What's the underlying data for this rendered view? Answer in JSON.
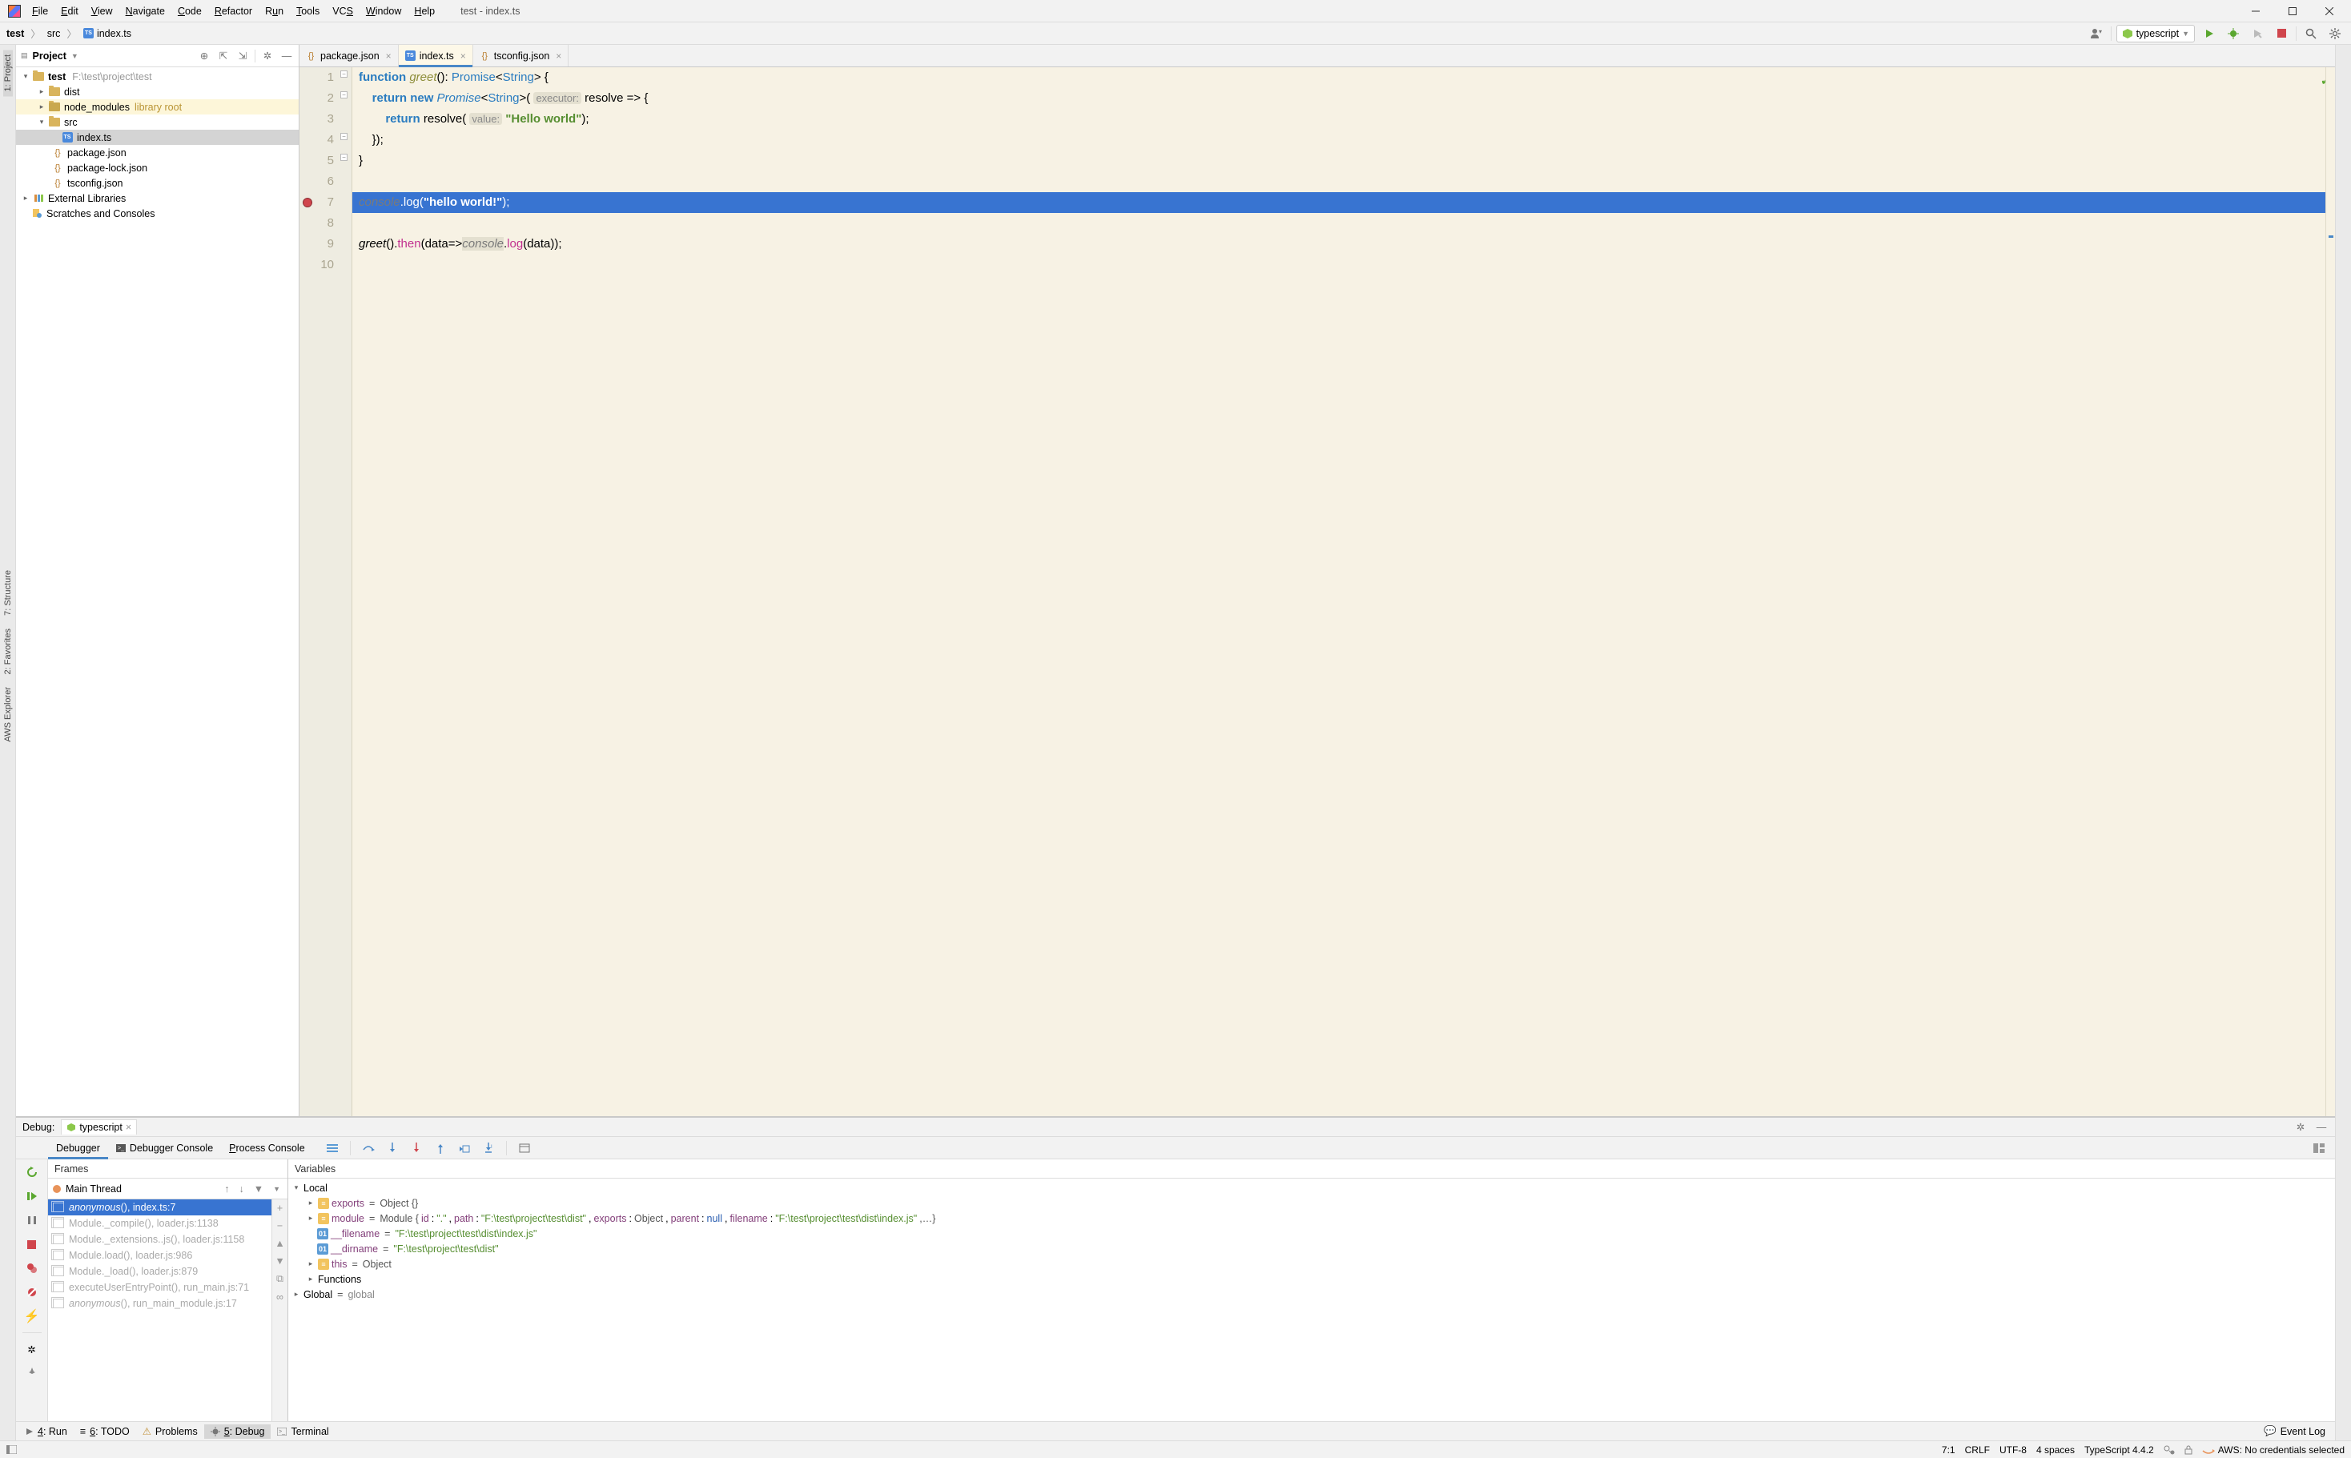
{
  "window": {
    "title": "test - index.ts"
  },
  "menu": {
    "items": [
      "File",
      "Edit",
      "View",
      "Navigate",
      "Code",
      "Refactor",
      "Run",
      "Tools",
      "VCS",
      "Window",
      "Help"
    ]
  },
  "breadcrumb": {
    "parts": [
      "test",
      "src",
      "index.ts"
    ]
  },
  "run_config": {
    "label": "typescript"
  },
  "project_tool": {
    "title": "Project",
    "root": {
      "name": "test",
      "path": "F:\\test\\project\\test"
    },
    "items": {
      "dist": "dist",
      "node_modules": "node_modules",
      "node_modules_note": "library root",
      "src": "src",
      "indexts": "index.ts",
      "packagejson": "package.json",
      "packagelock": "package-lock.json",
      "tsconfig": "tsconfig.json",
      "ext_lib": "External Libraries",
      "scratches": "Scratches and Consoles"
    }
  },
  "tabs": {
    "t0": "package.json",
    "t1": "index.ts",
    "t2": "tsconfig.json"
  },
  "code": {
    "lines": [
      "1",
      "2",
      "3",
      "4",
      "5",
      "6",
      "7",
      "8",
      "9",
      "10"
    ],
    "l1": {
      "kw_function": "function",
      "name": "greet",
      "parens": "()",
      "colon": ": ",
      "type": "Promise",
      "lt": "<",
      "arg": "String",
      "gt": ">",
      "brace": " {"
    },
    "l2": {
      "kw_return": "return",
      "kw_new": "new",
      "type": "Promise",
      "lt": "<",
      "arg": "String",
      "gt": ">",
      "open": "( ",
      "hint": "executor:",
      "rest": " resolve => {"
    },
    "l3": {
      "kw_return": "return",
      "call": "resolve",
      "open": "( ",
      "hint": "value:",
      "sp": " ",
      "str": "\"Hello world\"",
      "close": ");"
    },
    "l4": {
      "text": "});"
    },
    "l5": {
      "text": "}"
    },
    "l7": {
      "obj": "console",
      "dot": ".",
      "method": "log",
      "open": "(",
      "str": "\"hello world!\"",
      "close": ");"
    },
    "l9": {
      "fn": "greet",
      "call1": "().",
      "then": "then",
      "open": "(",
      "param": "data=>",
      "obj": "console",
      "dot": ".",
      "method": "log",
      "open2": "(",
      "param2": "data",
      "close": "));"
    }
  },
  "debug": {
    "title": "Debug:",
    "config": "typescript",
    "tabs": {
      "debugger": "Debugger",
      "console": "Debugger Console",
      "process": "Process Console"
    },
    "frames_title": "Frames",
    "vars_title": "Variables",
    "thread": "Main Thread",
    "frames": {
      "f0": {
        "name": "anonymous",
        "suffix": "(), index.ts:7"
      },
      "f1": {
        "name": "Module._compile",
        "suffix": "(), loader.js:1138"
      },
      "f2": {
        "name": "Module._extensions..js",
        "suffix": "(), loader.js:1158"
      },
      "f3": {
        "name": "Module.load",
        "suffix": "(), loader.js:986"
      },
      "f4": {
        "name": "Module._load",
        "suffix": "(), loader.js:879"
      },
      "f5": {
        "name": "executeUserEntryPoint",
        "suffix": "(), run_main.js:71"
      },
      "f6": {
        "name": "anonymous",
        "suffix": "(), run_main_module.js:17"
      }
    },
    "vars": {
      "local": "Local",
      "exports_k": "exports",
      "exports_v": "Object {}",
      "module_k": "module",
      "module_pre": "Module {",
      "module_id_k": "id",
      "module_id_v": "\".\"",
      "module_path_k": "path",
      "module_path_v": "\"F:\\test\\project\\test\\dist\"",
      "module_exp_k": "exports",
      "module_exp_v": "Object",
      "module_par_k": "parent",
      "module_par_v": "null",
      "module_fn_k": "filename",
      "module_fn_v": "\"F:\\test\\project\\test\\dist\\index.js\"",
      "module_rest": ",…}",
      "filename_k": "__filename",
      "filename_v": "\"F:\\test\\project\\test\\dist\\index.js\"",
      "dirname_k": "__dirname",
      "dirname_v": "\"F:\\test\\project\\test\\dist\"",
      "this_k": "this",
      "this_v": "Object",
      "functions": "Functions",
      "global_k": "Global",
      "global_v": "global"
    }
  },
  "left_strip": {
    "project": "1: Project",
    "structure": "7: Structure",
    "favorites": "2: Favorites",
    "aws": "AWS Explorer"
  },
  "bottom_bar": {
    "run": "4: Run",
    "todo": "6: TODO",
    "problems": "Problems",
    "debug": "5: Debug",
    "terminal": "Terminal",
    "eventlog": "Event Log"
  },
  "status": {
    "pos": "7:1",
    "le": "CRLF",
    "enc": "UTF-8",
    "indent": "4 spaces",
    "lang": "TypeScript 4.4.2",
    "aws": "AWS: No credentials selected"
  }
}
